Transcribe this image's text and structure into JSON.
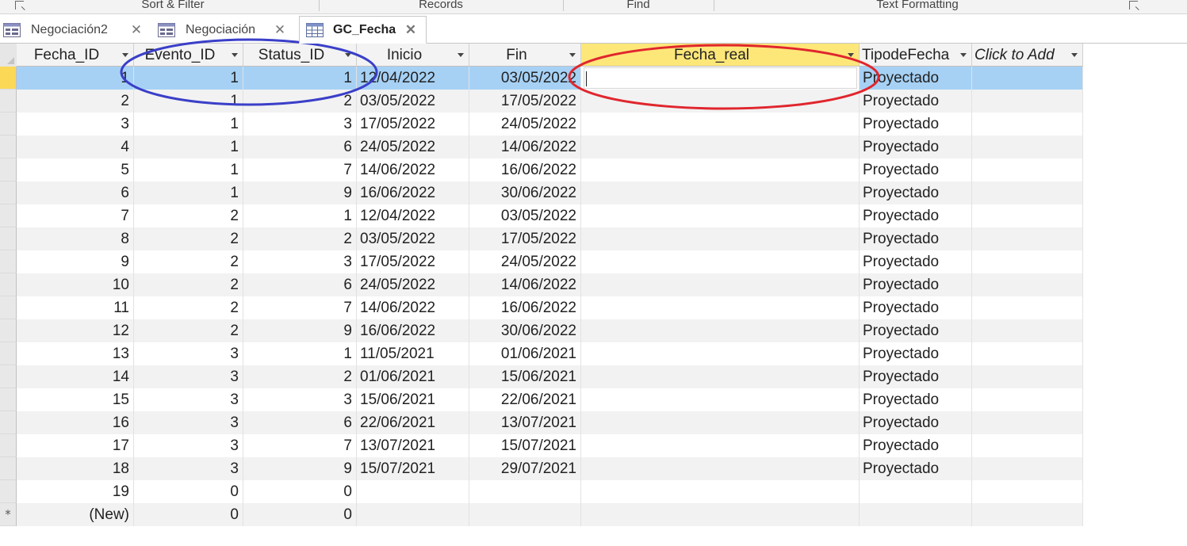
{
  "ribbon": {
    "groups": [
      "Sort & Filter",
      "Records",
      "Find",
      "Text Formatting"
    ]
  },
  "tabs": [
    {
      "label": "Negociación2",
      "active": false
    },
    {
      "label": "Negociación",
      "active": false
    },
    {
      "label": "GC_Fecha",
      "active": true
    }
  ],
  "table": {
    "columns": [
      "Fecha_ID",
      "Evento_ID",
      "Status_ID",
      "Inicio",
      "Fin",
      "Fecha_real",
      "TipodeFecha",
      "Click to Add"
    ],
    "rows": [
      [
        "1",
        "1",
        "1",
        "12/04/2022",
        "03/05/2022",
        "",
        "Proyectado"
      ],
      [
        "2",
        "1",
        "2",
        "03/05/2022",
        "17/05/2022",
        "",
        "Proyectado"
      ],
      [
        "3",
        "1",
        "3",
        "17/05/2022",
        "24/05/2022",
        "",
        "Proyectado"
      ],
      [
        "4",
        "1",
        "6",
        "24/05/2022",
        "14/06/2022",
        "",
        "Proyectado"
      ],
      [
        "5",
        "1",
        "7",
        "14/06/2022",
        "16/06/2022",
        "",
        "Proyectado"
      ],
      [
        "6",
        "1",
        "9",
        "16/06/2022",
        "30/06/2022",
        "",
        "Proyectado"
      ],
      [
        "7",
        "2",
        "1",
        "12/04/2022",
        "03/05/2022",
        "",
        "Proyectado"
      ],
      [
        "8",
        "2",
        "2",
        "03/05/2022",
        "17/05/2022",
        "",
        "Proyectado"
      ],
      [
        "9",
        "2",
        "3",
        "17/05/2022",
        "24/05/2022",
        "",
        "Proyectado"
      ],
      [
        "10",
        "2",
        "6",
        "24/05/2022",
        "14/06/2022",
        "",
        "Proyectado"
      ],
      [
        "11",
        "2",
        "7",
        "14/06/2022",
        "16/06/2022",
        "",
        "Proyectado"
      ],
      [
        "12",
        "2",
        "9",
        "16/06/2022",
        "30/06/2022",
        "",
        "Proyectado"
      ],
      [
        "13",
        "3",
        "1",
        "11/05/2021",
        "01/06/2021",
        "",
        "Proyectado"
      ],
      [
        "14",
        "3",
        "2",
        "01/06/2021",
        "15/06/2021",
        "",
        "Proyectado"
      ],
      [
        "15",
        "3",
        "3",
        "15/06/2021",
        "22/06/2021",
        "",
        "Proyectado"
      ],
      [
        "16",
        "3",
        "6",
        "22/06/2021",
        "13/07/2021",
        "",
        "Proyectado"
      ],
      [
        "17",
        "3",
        "7",
        "13/07/2021",
        "15/07/2021",
        "",
        "Proyectado"
      ],
      [
        "18",
        "3",
        "9",
        "15/07/2021",
        "29/07/2021",
        "",
        "Proyectado"
      ],
      [
        "19",
        "0",
        "0",
        "",
        "",
        "",
        ""
      ]
    ],
    "new_row": [
      "(New)",
      "0",
      "0",
      "",
      "",
      "",
      ""
    ],
    "new_row_marker": "*",
    "current_row_index": 0,
    "active_column": "Fecha_real"
  },
  "colors": {
    "selected_row": "#a6d1f5",
    "active_header": "#fde779",
    "alt_row": "#f2f2f2",
    "annotation_blue": "#3a3fc8",
    "annotation_red": "#e0262d"
  },
  "icons": {
    "tab": "table-icon",
    "close": "close-icon",
    "sort": "dropdown-arrow-icon",
    "new_record": "asterisk-icon"
  }
}
